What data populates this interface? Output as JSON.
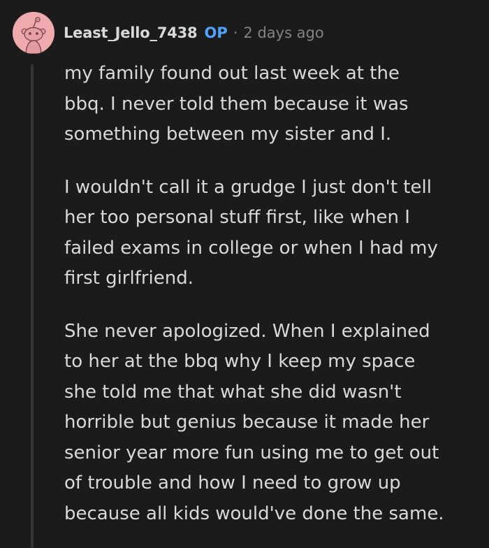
{
  "comment": {
    "author": "Least_Jello_7438",
    "op_badge": "OP",
    "separator": "·",
    "timestamp": "2 days ago",
    "avatar_color": "#f0a9ad",
    "accent_color": "#4fa3ff",
    "paragraphs": [
      {
        "lines": [
          "my family found out last week at the",
          "bbq. I never told them because it was",
          "something between my sister and I."
        ]
      },
      {
        "lines": [
          "I wouldn't call it a grudge I just don't tell",
          "her too personal stuff first, like when I",
          "failed exams in college or when I had my",
          "first girlfriend."
        ]
      },
      {
        "lines": [
          "She never apologized. When I explained",
          "to her at the bbq why I keep my space",
          "she told me that what she did wasn't",
          "horrible but genius because it made her",
          "senior year more fun using me to get out",
          "of trouble and how I need to grow up",
          "because all kids would've done the same."
        ]
      }
    ]
  }
}
